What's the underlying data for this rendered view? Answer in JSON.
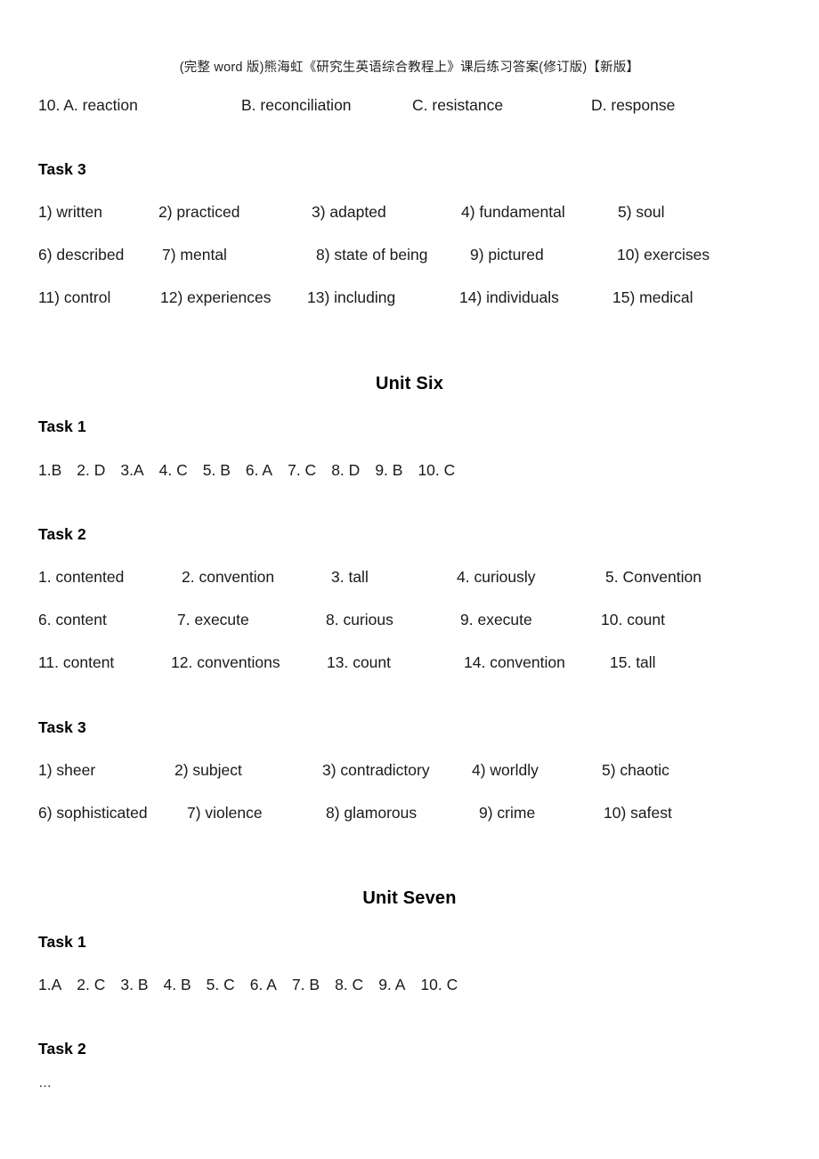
{
  "header": {
    "running_title": "(完整 word 版)熊海虹《研究生英语综合教程上》课后练习答案(修订版)【新版】"
  },
  "question10": {
    "options": [
      "10. A. reaction",
      "B. reconciliation",
      "C. resistance",
      "D. response"
    ]
  },
  "unit_five_task3": {
    "heading": "Task 3",
    "rows": [
      [
        "1) written",
        "2) practiced",
        "3) adapted",
        "4) fundamental",
        "5) soul"
      ],
      [
        "6) described",
        "7) mental",
        "8) state of being",
        "9) pictured",
        "10) exercises"
      ],
      [
        "11) control",
        "12) experiences",
        "13) including",
        "14) individuals",
        "15) medical"
      ]
    ]
  },
  "unit_six": {
    "title": "Unit Six",
    "task1": {
      "heading": "Task 1",
      "answers": [
        "1.B",
        "2. D",
        "3.A",
        "4. C",
        "5. B",
        "6. A",
        "7. C",
        "8. D",
        "9. B",
        "10. C"
      ]
    },
    "task2": {
      "heading": "Task 2",
      "rows": [
        [
          "1. contented",
          "2. convention",
          "3. tall",
          "4. curiously",
          "5. Convention"
        ],
        [
          "6. content",
          "7. execute",
          "8. curious",
          "9. execute",
          "10. count"
        ],
        [
          "11. content",
          "12. conventions",
          "13. count",
          "14. convention",
          "15. tall"
        ]
      ]
    },
    "task3": {
      "heading": "Task 3",
      "rows": [
        [
          "1) sheer",
          "2) subject",
          "3) contradictory",
          "4) worldly",
          "5) chaotic"
        ],
        [
          "6) sophisticated",
          "7) violence",
          "8) glamorous",
          "9) crime",
          "10) safest"
        ]
      ]
    }
  },
  "unit_seven": {
    "title": "Unit Seven",
    "task1": {
      "heading": "Task 1",
      "answers": [
        "1.A",
        "2. C",
        "3. B",
        "4. B",
        "5. C",
        "6. A",
        "7. B",
        "8. C",
        "9. A",
        "10. C"
      ]
    },
    "task2": {
      "heading": "Task 2",
      "continuation": "…"
    }
  }
}
